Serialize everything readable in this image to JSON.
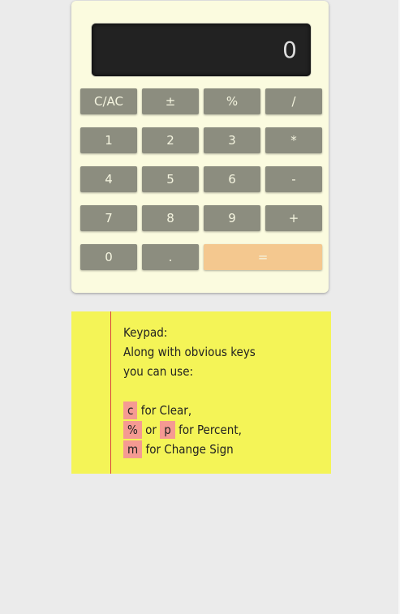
{
  "calculator": {
    "display_value": "0",
    "keys": [
      {
        "label": "C/AC",
        "name": "clear-button"
      },
      {
        "label": "±",
        "name": "change-sign-button"
      },
      {
        "label": "%",
        "name": "percent-button"
      },
      {
        "label": "/",
        "name": "divide-button"
      },
      {
        "label": "1",
        "name": "digit-1-button"
      },
      {
        "label": "2",
        "name": "digit-2-button"
      },
      {
        "label": "3",
        "name": "digit-3-button"
      },
      {
        "label": "*",
        "name": "multiply-button"
      },
      {
        "label": "4",
        "name": "digit-4-button"
      },
      {
        "label": "5",
        "name": "digit-5-button"
      },
      {
        "label": "6",
        "name": "digit-6-button"
      },
      {
        "label": "-",
        "name": "subtract-button"
      },
      {
        "label": "7",
        "name": "digit-7-button"
      },
      {
        "label": "8",
        "name": "digit-8-button"
      },
      {
        "label": "9",
        "name": "digit-9-button"
      },
      {
        "label": "+",
        "name": "add-button"
      },
      {
        "label": "0",
        "name": "digit-0-button"
      },
      {
        "label": ".",
        "name": "decimal-button"
      },
      {
        "label": "=",
        "name": "equals-button"
      }
    ]
  },
  "note": {
    "title": "Keypad:",
    "line1": "Along with obvious keys",
    "line2": "you can use:",
    "clear_key": "c",
    "clear_text": "for Clear,",
    "percent_key": "%",
    "percent_or": "or",
    "percent_alt_key": "p",
    "percent_text": "for Percent,",
    "sign_key": "m",
    "sign_text": "for Change Sign"
  },
  "colors": {
    "background": "#ebebeb",
    "calculator_body": "#fbfbdf",
    "display": "#222222",
    "key": "#8c8d7f",
    "equals_key": "#f4c88f",
    "note": "#f4f457",
    "note_margin_line": "#d9443f",
    "key_highlight": "#f59a92"
  }
}
